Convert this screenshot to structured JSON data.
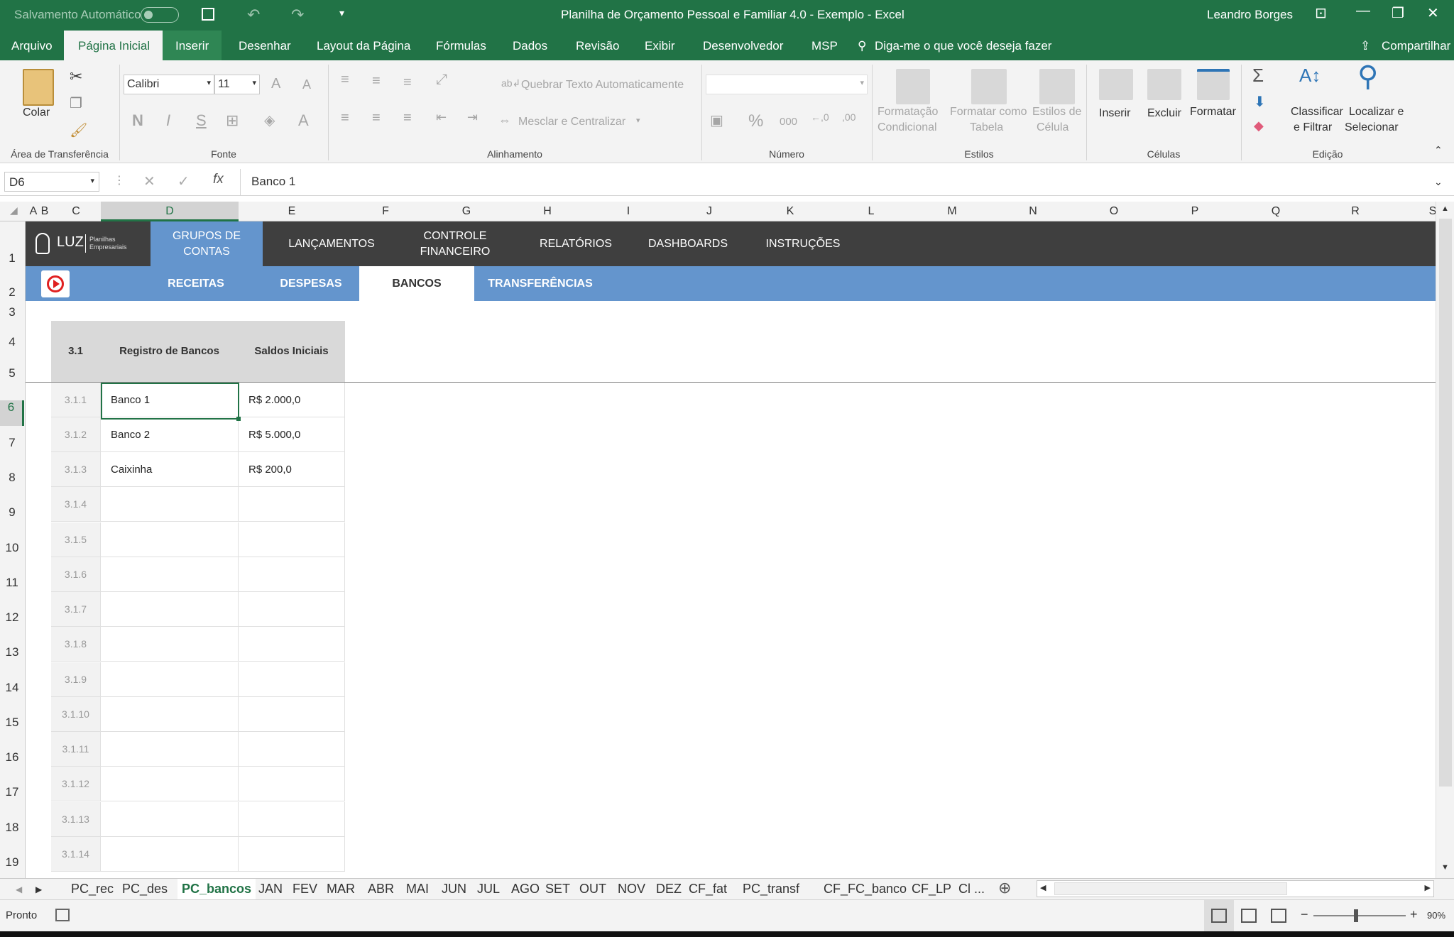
{
  "title": {
    "autosave": "Salvamento Automático",
    "doc": "Planilha de Orçamento Pessoal e Familiar 4.0 - Exemplo  -  Excel",
    "user": "Leandro Borges"
  },
  "menu": {
    "tabs": [
      "Arquivo",
      "Página Inicial",
      "Inserir",
      "Desenhar",
      "Layout da Página",
      "Fórmulas",
      "Dados",
      "Revisão",
      "Exibir",
      "Desenvolvedor",
      "MSP"
    ],
    "tell": "Diga-me o que você deseja fazer",
    "share": "Compartilhar"
  },
  "ribbon": {
    "paste": "Colar",
    "font": "Calibri",
    "size": "11",
    "bold": "N",
    "italic": "I",
    "underline": "S",
    "wrap": "Quebrar Texto Automaticamente",
    "merge": "Mesclar e Centralizar",
    "percent": "%",
    "thousands": "000",
    "cond1": "Formatação",
    "cond2": "Condicional",
    "table1": "Formatar como",
    "table2": "Tabela",
    "style1": "Estilos de",
    "style2": "Célula",
    "insert": "Inserir",
    "delete": "Excluir",
    "format": "Formatar",
    "sort1": "Classificar",
    "sort2": "e Filtrar",
    "find1": "Localizar e",
    "find2": "Selecionar",
    "groups": [
      "Área de Transferência",
      "Fonte",
      "Alinhamento",
      "Número",
      "Estilos",
      "Células",
      "Edição"
    ]
  },
  "formula": {
    "namebox": "D6",
    "value": "Banco 1",
    "fx": "fx"
  },
  "columns": [
    "A",
    "B",
    "C",
    "D",
    "E",
    "F",
    "G",
    "H",
    "I",
    "J",
    "K",
    "L",
    "M",
    "N",
    "O",
    "P",
    "Q",
    "R",
    "S"
  ],
  "rows": [
    "1",
    "2",
    "3",
    "4",
    "5",
    "6",
    "7",
    "8",
    "9",
    "10",
    "11",
    "12",
    "13",
    "14",
    "15",
    "16",
    "17",
    "18",
    "19"
  ],
  "nav": {
    "logo": "LUZ",
    "logo_sub1": "Planilhas",
    "logo_sub2": "Empresariais",
    "items": [
      "GRUPOS DE\nCONTAS",
      "LANÇAMENTOS",
      "CONTROLE\nFINANCEIRO",
      "RELATÓRIOS",
      "DASHBOARDS",
      "INSTRUÇÕES"
    ],
    "sub": [
      "RECEITAS",
      "DESPESAS",
      "BANCOS",
      "TRANSFERÊNCIAS"
    ]
  },
  "table": {
    "h_num": "3.1",
    "h_name": "Registro de Bancos",
    "h_bal": "Saldos Iniciais",
    "rows": [
      {
        "n": "3.1.1",
        "name": "Banco 1",
        "bal": "R$ 2.000,0"
      },
      {
        "n": "3.1.2",
        "name": "Banco 2",
        "bal": "R$ 5.000,0"
      },
      {
        "n": "3.1.3",
        "name": "Caixinha",
        "bal": "R$ 200,0"
      },
      {
        "n": "3.1.4",
        "name": "",
        "bal": ""
      },
      {
        "n": "3.1.5",
        "name": "",
        "bal": ""
      },
      {
        "n": "3.1.6",
        "name": "",
        "bal": ""
      },
      {
        "n": "3.1.7",
        "name": "",
        "bal": ""
      },
      {
        "n": "3.1.8",
        "name": "",
        "bal": ""
      },
      {
        "n": "3.1.9",
        "name": "",
        "bal": ""
      },
      {
        "n": "3.1.10",
        "name": "",
        "bal": ""
      },
      {
        "n": "3.1.11",
        "name": "",
        "bal": ""
      },
      {
        "n": "3.1.12",
        "name": "",
        "bal": ""
      },
      {
        "n": "3.1.13",
        "name": "",
        "bal": ""
      },
      {
        "n": "3.1.14",
        "name": "",
        "bal": ""
      }
    ]
  },
  "sheets": [
    "PC_rec",
    "PC_des",
    "PC_bancos",
    "JAN",
    "FEV",
    "MAR",
    "ABR",
    "MAI",
    "JUN",
    "JUL",
    "AGO",
    "SET",
    "OUT",
    "NOV",
    "DEZ",
    "CF_fat",
    "PC_transf",
    "CF_FC_banco",
    "CF_LP",
    "Cl ..."
  ],
  "status": {
    "ready": "Pronto",
    "zoom": "90%"
  }
}
